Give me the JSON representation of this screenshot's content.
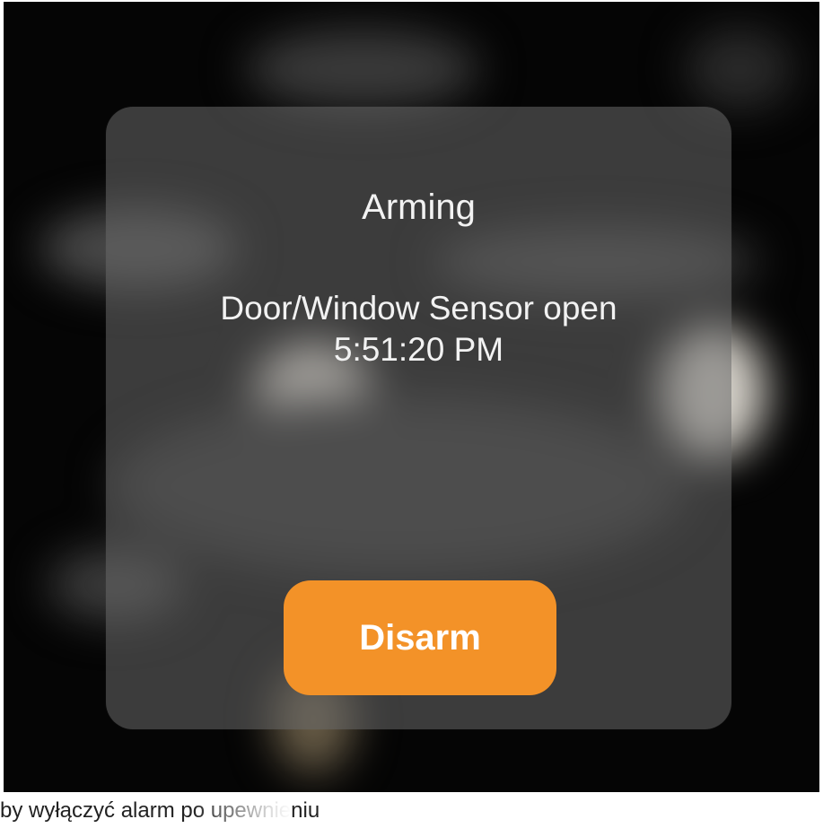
{
  "dialog": {
    "title": "Arming",
    "message_line1": "Door/Window Sensor open",
    "message_line2": "5:51:20 PM",
    "disarm_label": "Disarm",
    "button_color": "#f39228"
  },
  "caption": {
    "text": "by wyłączyć alarm po upewnieniu"
  }
}
